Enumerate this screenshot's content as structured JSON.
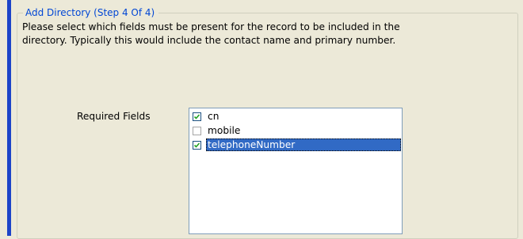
{
  "group": {
    "legend": "Add Directory (Step 4 Of 4)"
  },
  "instructions": "Please select which fields must be present for the record to be included in the\ndirectory.  Typically this would include the contact name and primary number.",
  "required_fields": {
    "label": "Required Fields",
    "items": [
      {
        "label": "cn",
        "checked": true,
        "selected": false
      },
      {
        "label": "mobile",
        "checked": false,
        "selected": false
      },
      {
        "label": "telephoneNumber",
        "checked": true,
        "selected": true
      }
    ]
  },
  "colors": {
    "window_bg": "#ECE9D8",
    "legend_text": "#0046D5",
    "selection_bg": "#316AC5",
    "accent_bar": "#1C44C8"
  }
}
